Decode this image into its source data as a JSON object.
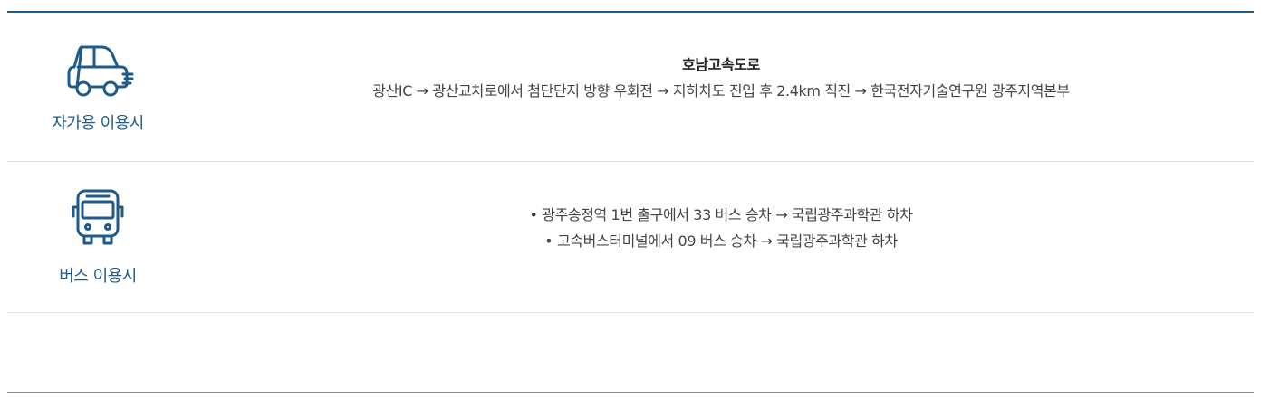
{
  "theme": {
    "accent": "#1e5b8a",
    "text": "#444444",
    "divider": "#e3e3e3"
  },
  "directions": {
    "car": {
      "icon": "car-icon",
      "label": "자가용 이용시",
      "route_title": "호남고속도로",
      "route_detail": "광산IC → 광산교차로에서 첨단단지 방향 우회전 → 지하차도 진입 후 2.4km 직진 → 한국전자기술연구원 광주지역본부"
    },
    "bus": {
      "icon": "bus-icon",
      "label": "버스 이용시",
      "routes": [
        "• 광주송정역 1번 출구에서 33 버스 승차 → 국립광주과학관 하차",
        "• 고속버스터미널에서 09 버스 승차 → 국립광주과학관 하차"
      ]
    }
  }
}
